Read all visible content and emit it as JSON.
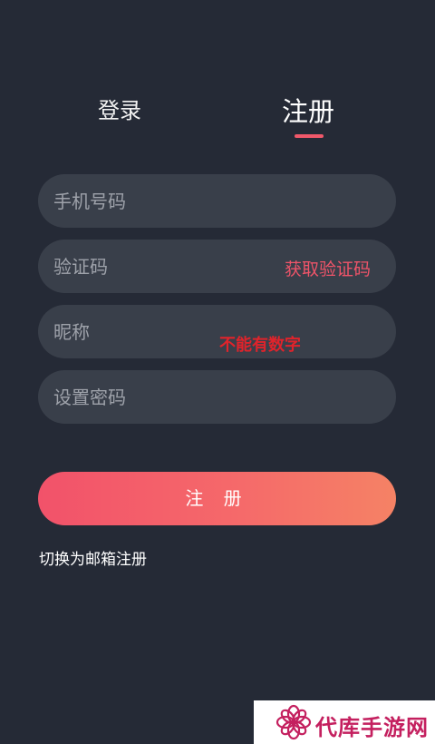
{
  "tabs": {
    "login": "登录",
    "register": "注册"
  },
  "form": {
    "phone_placeholder": "手机号码",
    "code_placeholder": "验证码",
    "get_code_label": "获取验证码",
    "nickname_placeholder": "昵称",
    "password_placeholder": "设置密码",
    "submit_label": "注 册"
  },
  "annotation": "不能有数字",
  "switch_label": "切换为邮箱注册",
  "watermark": {
    "text": "代库手游网",
    "logo_icon": "flower-icon"
  },
  "colors": {
    "background": "#252a36",
    "field": "#393f4a",
    "accent": "#f0586a",
    "annotation": "#e0232b",
    "gradient_start": "#f2526a",
    "gradient_end": "#f58265"
  }
}
